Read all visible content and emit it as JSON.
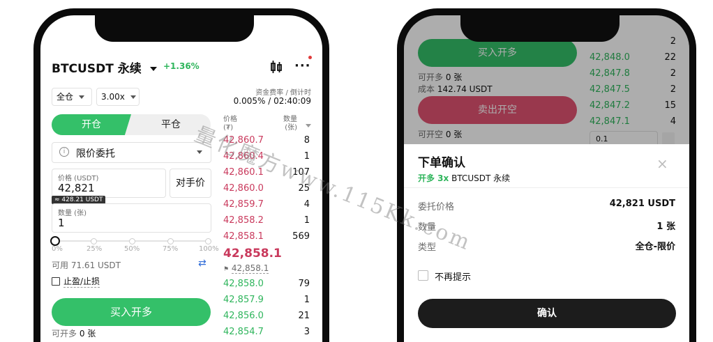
{
  "left": {
    "header": {
      "pair": "BTCUSDT 永续",
      "change": "+1.36%"
    },
    "margin_mode": "全仓",
    "leverage": "3.00x",
    "funding": {
      "label": "资金费率 / 倒计时",
      "value": "0.005% / 02:40:09"
    },
    "tabs": {
      "open": "开仓",
      "close": "平仓"
    },
    "order_type": "限价委托",
    "price": {
      "label": "价格 (USDT)",
      "value": "42,821",
      "approx": "≈ 428.21 USDT",
      "counterparty_btn": "对手价"
    },
    "quantity": {
      "label": "数量 (张)",
      "value": "1"
    },
    "slider": {
      "value_percent": 0,
      "ticks": [
        "0%",
        "25%",
        "50%",
        "75%",
        "100%"
      ]
    },
    "available": {
      "label": "可用",
      "value": "71.61 USDT"
    },
    "tpsl": "止盈/止损",
    "buy_button": "买入开多",
    "can_open_long": {
      "label": "可开多",
      "value": "0 张"
    },
    "orderbook": {
      "price_header": "价格\n(₮)",
      "qty_header": "数量\n(张)",
      "asks": [
        {
          "price": "42,860.7",
          "qty": "8"
        },
        {
          "price": "42,860.4",
          "qty": "1"
        },
        {
          "price": "42,860.1",
          "qty": "107"
        },
        {
          "price": "42,860.0",
          "qty": "25"
        },
        {
          "price": "42,859.7",
          "qty": "4"
        },
        {
          "price": "42,858.2",
          "qty": "1"
        },
        {
          "price": "42,858.1",
          "qty": "569"
        }
      ],
      "last_price": "42,858.1",
      "mark_price": "42,858.1",
      "bids": [
        {
          "price": "42,858.0",
          "qty": "79"
        },
        {
          "price": "42,857.9",
          "qty": "1"
        },
        {
          "price": "42,856.0",
          "qty": "21"
        },
        {
          "price": "42,854.7",
          "qty": "3"
        }
      ]
    }
  },
  "right": {
    "buy_button": "买入开多",
    "sell_button": "卖出开空",
    "can_open_long": {
      "label": "可开多",
      "value": "0 张"
    },
    "cost": {
      "label": "成本",
      "value": "142.74 USDT"
    },
    "can_open_short": {
      "label": "可开空",
      "value": "0 张"
    },
    "qty_input_value": "0.1",
    "orderbook_bids": [
      {
        "price": "",
        "qty": "2"
      },
      {
        "price": "42,848.0",
        "qty": "22"
      },
      {
        "price": "42,847.8",
        "qty": "2"
      },
      {
        "price": "42,847.5",
        "qty": "2"
      },
      {
        "price": "42,847.2",
        "qty": "15"
      },
      {
        "price": "42,847.1",
        "qty": "4"
      }
    ],
    "sheet": {
      "title": "下单确认",
      "subtitle_side": "开多 3x",
      "subtitle_pair": "BTCUSDT 永续",
      "rows": [
        {
          "label": "委托价格",
          "value": "42,821 USDT"
        },
        {
          "label": "数量",
          "value": "1 张"
        },
        {
          "label": "类型",
          "value": "全仓-限价"
        }
      ],
      "dont_show": "不再提示",
      "confirm": "确认"
    }
  },
  "watermark": "量化魔方www.115Kk.com"
}
